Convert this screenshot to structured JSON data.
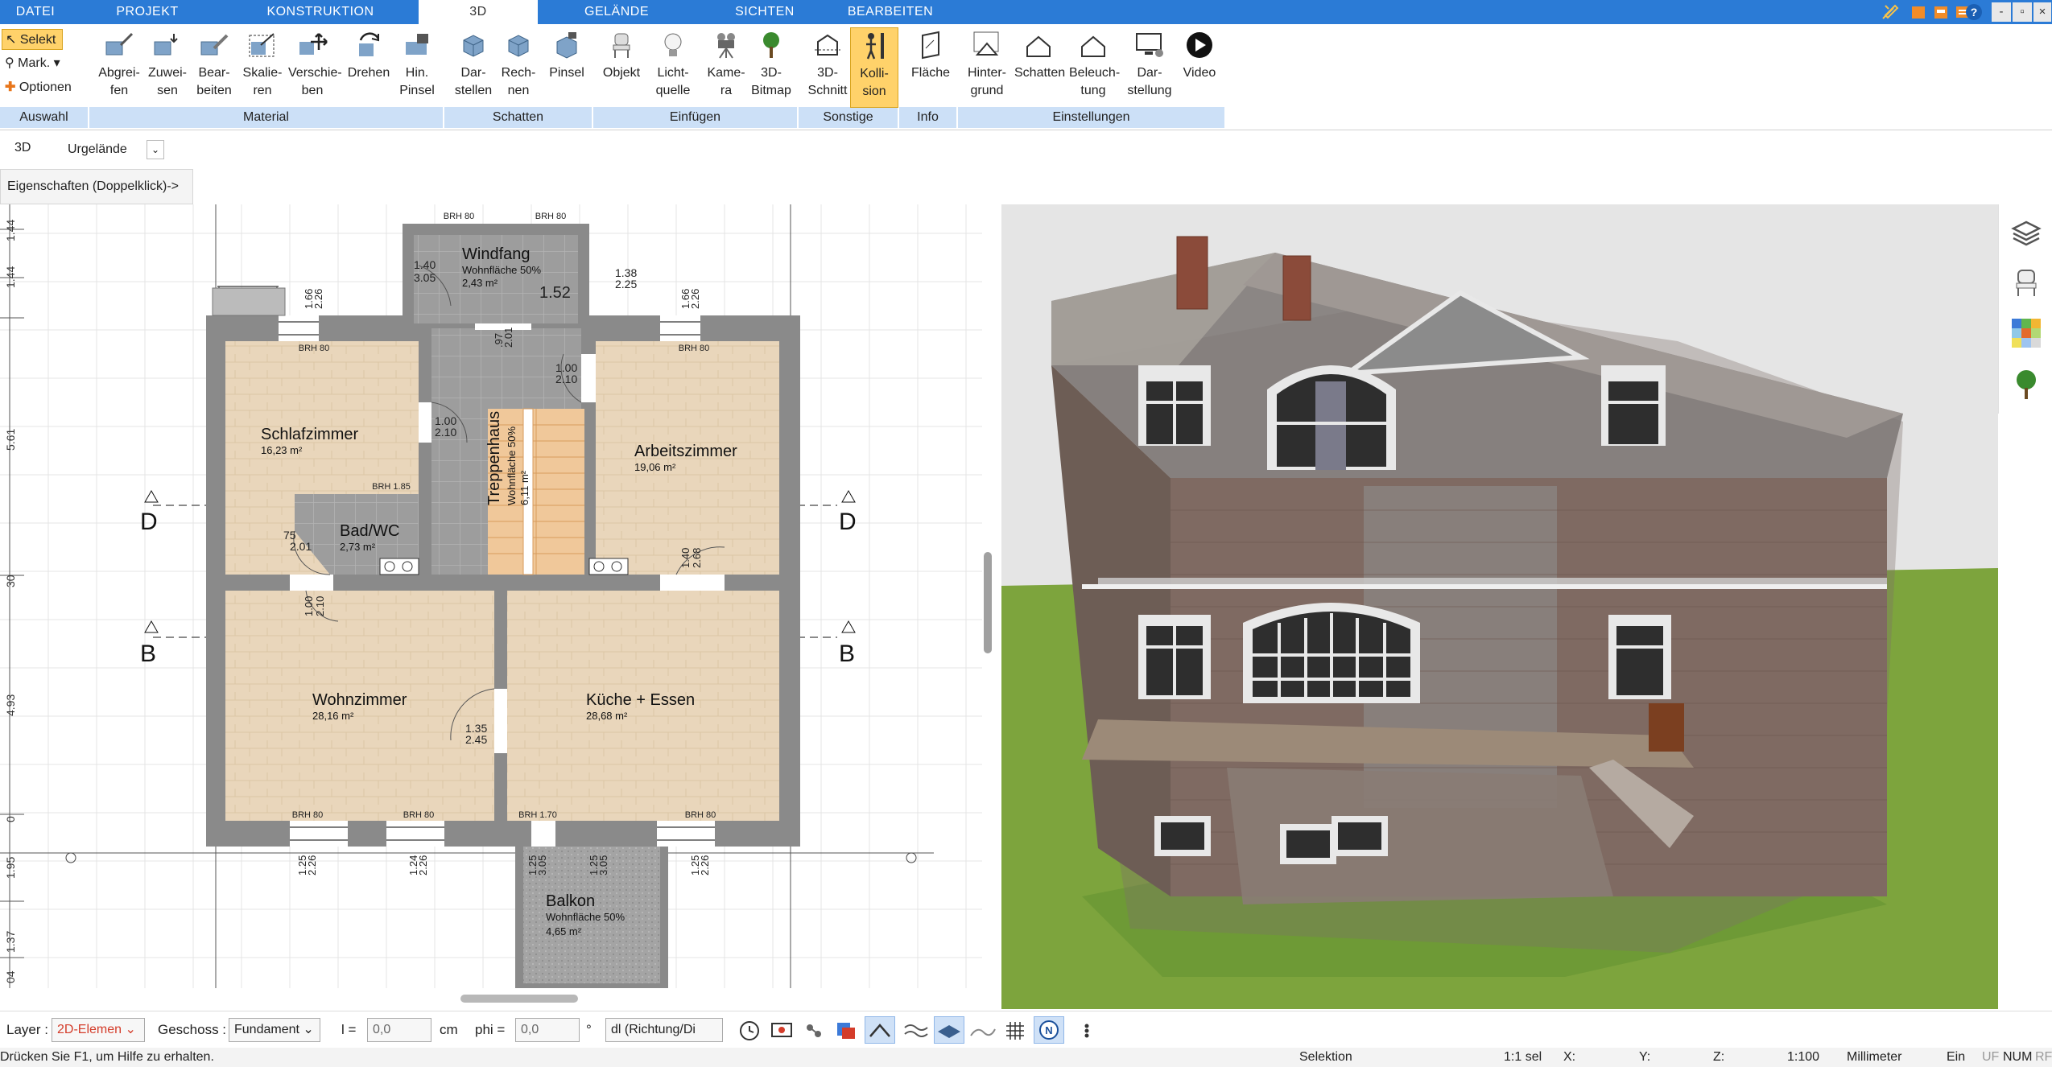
{
  "tabs": [
    {
      "label": "DATEI",
      "active": false
    },
    {
      "label": "PROJEKT",
      "active": false
    },
    {
      "label": "KONSTRUKTION",
      "active": false
    },
    {
      "label": "3D",
      "active": true
    },
    {
      "label": "GELÄNDE",
      "active": false
    },
    {
      "label": "SICHTEN",
      "active": false
    },
    {
      "label": "BEARBEITEN",
      "active": false
    }
  ],
  "window_controls": [
    "tools-icon",
    "min-icon",
    "restore-icon",
    "close-icon"
  ],
  "auswahl": {
    "select_label": "Selekt",
    "mark_label": "Mark.",
    "options_label": "Optionen",
    "group_label": "Auswahl"
  },
  "ribbon_groups": [
    {
      "label": "Material",
      "buttons": [
        "Abgrei-\nfen",
        "Zuwei-\nsen",
        "Bear-\nbeiten",
        "Skalie-\nren",
        "Verschie-\nben",
        "Drehen",
        "Hin.\nPinsel"
      ]
    },
    {
      "label": "Schatten",
      "buttons": [
        "Dar-\nstellen",
        "Rech-\nnen",
        "Pinsel"
      ]
    },
    {
      "label": "Einfügen",
      "buttons": [
        "Objekt",
        "Licht-\nquelle",
        "Kame-\nra",
        "3D-\nBitmap"
      ]
    },
    {
      "label": "Sonstige",
      "buttons": [
        "3D-\nSchnitt",
        "Kolli-\nsion"
      ]
    },
    {
      "label": "Info",
      "buttons": [
        "Fläche"
      ]
    },
    {
      "label": "Einstellungen",
      "buttons": [
        "Hinter-\ngrund",
        "Schatten",
        "Beleuch-\ntung",
        "Dar-\nstellung",
        "Video"
      ]
    }
  ],
  "toolbar2": {
    "mode": "3D",
    "terrain": "Urgelände"
  },
  "properties_hint": "Eigenschaften (Doppelklick)->",
  "plan": {
    "rooms": [
      {
        "name": "Windfang",
        "sub": "Wohnfläche  50%",
        "area": "2,43 m²"
      },
      {
        "name": "Schlafzimmer",
        "sub": "",
        "area": "16,23 m²"
      },
      {
        "name": "Treppenhaus",
        "sub": "Wohnfläche  50%",
        "area": "6,11 m²"
      },
      {
        "name": "Arbeitszimmer",
        "sub": "",
        "area": "19,06 m²"
      },
      {
        "name": "Bad/WC",
        "sub": "",
        "area": "2,73 m²"
      },
      {
        "name": "Wohnzimmer",
        "sub": "",
        "area": "28,16 m²"
      },
      {
        "name": "Küche + Essen",
        "sub": "",
        "area": "28,68 m²"
      },
      {
        "name": "Balkon",
        "sub": "Wohnfläche  50%",
        "area": "4,65 m²"
      }
    ],
    "section_markers": [
      "D",
      "D",
      "B",
      "B"
    ],
    "labels": {
      "brh80": "BRH 80",
      "brh185": "BRH 1.85",
      "brh170": "BRH 1.70",
      "door_140_305": [
        "1.40",
        "3.05"
      ],
      "door_138_225": [
        "1.38",
        "2.25"
      ],
      "stair_152": "1.52",
      "door_100_210": [
        "1.00",
        "2.10"
      ],
      "door_135_245": [
        "1.35",
        "2.45"
      ],
      "door_75_201": [
        "75",
        "2.01"
      ],
      "door_140_268": [
        "1.40",
        "2.68"
      ],
      "dim_166_226": [
        "1.66",
        "2.26"
      ],
      "dim_125_226": [
        "1.25",
        "2.26"
      ],
      "dim_124_226": [
        "1.24",
        "2.26"
      ],
      "dim_125_305": [
        "1.25",
        "3.05"
      ],
      "dim_097_201": [
        ".97",
        "2.01"
      ],
      "ruler": [
        "1.44",
        "1.44",
        "5.61",
        "30",
        "4.93",
        "0",
        "1.95",
        "1.37",
        "04"
      ]
    }
  },
  "statusbar": {
    "layer_label": "Layer :",
    "layer_value": "2D-Elemen",
    "floor_label": "Geschoss :",
    "floor_value": "Fundament",
    "l_label": "l =",
    "l_value": "0,0",
    "unit": "cm",
    "phi_label": "phi =",
    "phi_value": "0,0",
    "phi_unit": "°",
    "dl_value": "dl (Richtung/Di"
  },
  "status2": {
    "help": "Drücken Sie F1, um Hilfe zu erhalten.",
    "mode": "Selektion",
    "ratio": "1:1 sel",
    "x": "X:",
    "y": "Y:",
    "z": "Z:",
    "scale": "1:100",
    "unit": "Millimeter",
    "ein": "Ein",
    "uf": "UF",
    "num": "NUM",
    "rf": "RF"
  },
  "colors": {
    "accent": "#2b7bd6",
    "group_bg": "#cce0f7",
    "active_btn": "#ffd26a",
    "wall": "#8a8a8a",
    "floor_wood": "#e8d4b8",
    "floor_tile": "#9a9a9a",
    "grass": "#7aa23a"
  }
}
